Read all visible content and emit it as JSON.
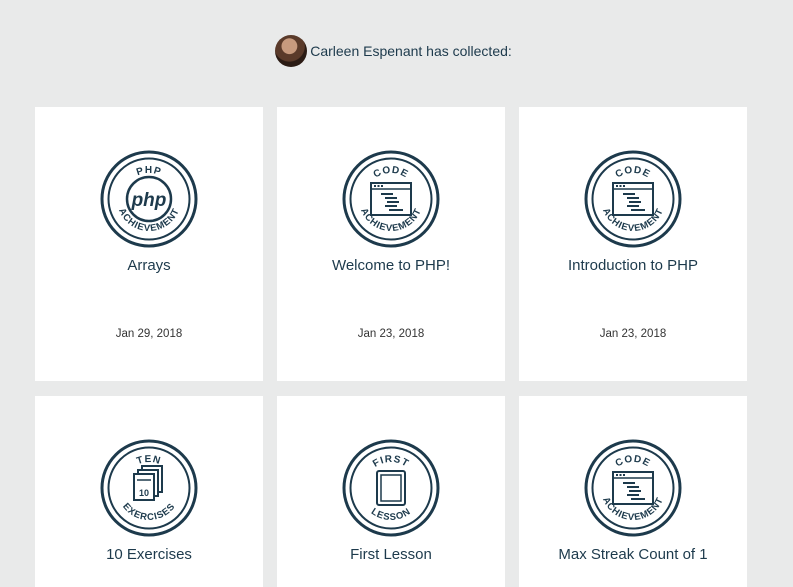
{
  "header": {
    "collected_text": "Carleen Espenant has collected:"
  },
  "achievements": [
    {
      "title": "Arrays",
      "date": "Jan 29, 2018",
      "badge_top": "PHP",
      "badge_bottom": "ACHIEVEMENT",
      "badge_center": "php",
      "icon": "php-logo-icon"
    },
    {
      "title": "Welcome to PHP!",
      "date": "Jan 23, 2018",
      "badge_top": "CODE",
      "badge_bottom": "ACHIEVEMENT",
      "icon": "code-window-icon"
    },
    {
      "title": "Introduction to PHP",
      "date": "Jan 23, 2018",
      "badge_top": "CODE",
      "badge_bottom": "ACHIEVEMENT",
      "icon": "code-window-icon"
    },
    {
      "title": "10 Exercises",
      "badge_top": "TEN",
      "badge_bottom": "EXERCISES",
      "badge_center": "10",
      "icon": "stacked-pages-icon"
    },
    {
      "title": "First Lesson",
      "badge_top": "FIRST",
      "badge_bottom": "LESSON",
      "icon": "book-icon"
    },
    {
      "title": "Max Streak Count of 1",
      "badge_top": "CODE",
      "badge_bottom": "ACHIEVEMENT",
      "icon": "code-window-icon"
    }
  ],
  "colors": {
    "background": "#e9eaea",
    "card": "#ffffff",
    "badge": "#1d3a4c"
  }
}
